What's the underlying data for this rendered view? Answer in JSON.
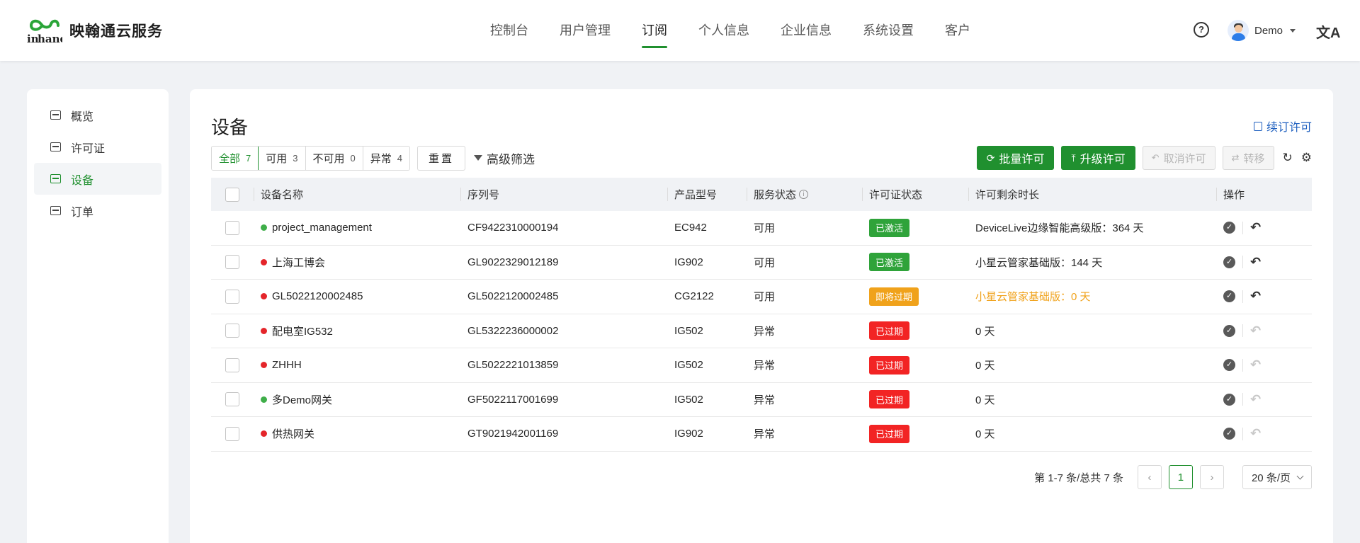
{
  "header": {
    "logo_text": "映翰通云服务",
    "nav": [
      "控制台",
      "用户管理",
      "订阅",
      "个人信息",
      "企业信息",
      "系统设置",
      "客户"
    ],
    "active_nav": 2,
    "help_glyph": "?",
    "user_name": "Demo",
    "lang_glyph": "文A"
  },
  "sidebar": {
    "items": [
      {
        "label": "概览",
        "icon": "dashboard-icon"
      },
      {
        "label": "许可证",
        "icon": "license-icon"
      },
      {
        "label": "设备",
        "icon": "device-icon"
      },
      {
        "label": "订单",
        "icon": "order-icon"
      }
    ],
    "active_index": 2
  },
  "main": {
    "title": "设备",
    "renew_label": "续订许可",
    "filters": [
      {
        "label": "全部",
        "count": "7"
      },
      {
        "label": "可用",
        "count": "3"
      },
      {
        "label": "不可用",
        "count": "0"
      },
      {
        "label": "异常",
        "count": "4"
      }
    ],
    "reset_label": "重置",
    "advanced_filter_label": "高级筛选",
    "batch_license_label": "批量许可",
    "upgrade_license_label": "升级许可",
    "cancel_license_label": "取消许可",
    "transfer_label": "转移"
  },
  "table": {
    "columns": [
      "设备名称",
      "序列号",
      "产品型号",
      "服务状态",
      "许可证状态",
      "许可剩余时长",
      "操作"
    ],
    "rows": [
      {
        "name": "project_management",
        "online": true,
        "sn": "CF9422310000194",
        "model": "EC942",
        "service": "可用",
        "license": "已激活",
        "license_kind": "active",
        "duration": "DeviceLive边缘智能高级版：364 天",
        "duration_warn": false,
        "undo_enabled": true
      },
      {
        "name": "上海工博会",
        "online": false,
        "sn": "GL9022329012189",
        "model": "IG902",
        "service": "可用",
        "license": "已激活",
        "license_kind": "active",
        "duration": "小星云管家基础版：144 天",
        "duration_warn": false,
        "undo_enabled": true
      },
      {
        "name": "GL5022120002485",
        "online": false,
        "sn": "GL5022120002485",
        "model": "CG2122",
        "service": "可用",
        "license": "即将过期",
        "license_kind": "expiring",
        "duration": "小星云管家基础版：0 天",
        "duration_warn": true,
        "undo_enabled": true
      },
      {
        "name": "配电室IG532",
        "online": false,
        "sn": "GL5322236000002",
        "model": "IG502",
        "service": "异常",
        "license": "已过期",
        "license_kind": "expired",
        "duration": "0 天",
        "duration_warn": false,
        "undo_enabled": false
      },
      {
        "name": "ZHHH",
        "online": false,
        "sn": "GL5022221013859",
        "model": "IG502",
        "service": "异常",
        "license": "已过期",
        "license_kind": "expired",
        "duration": "0 天",
        "duration_warn": false,
        "undo_enabled": false
      },
      {
        "name": "多Demo网关",
        "online": true,
        "sn": "GF5022117001699",
        "model": "IG502",
        "service": "异常",
        "license": "已过期",
        "license_kind": "expired",
        "duration": "0 天",
        "duration_warn": false,
        "undo_enabled": false
      },
      {
        "name": "供热网关",
        "online": false,
        "sn": "GT9021942001169",
        "model": "IG902",
        "service": "异常",
        "license": "已过期",
        "license_kind": "expired",
        "duration": "0 天",
        "duration_warn": false,
        "undo_enabled": false
      }
    ]
  },
  "pagination": {
    "total_text": "第 1-7 条/总共 7 条",
    "current_page": "1",
    "page_size": "20 条/页"
  },
  "colors": {
    "brand_green": "#20902f",
    "online_dot": "#3fae49",
    "offline_dot": "#e4252a",
    "badge_active": "#2fa33a",
    "badge_expiring": "#f0a21b",
    "badge_expired": "#f22424",
    "warn_text": "#f0a21b",
    "link_blue": "#1e5fbf"
  }
}
